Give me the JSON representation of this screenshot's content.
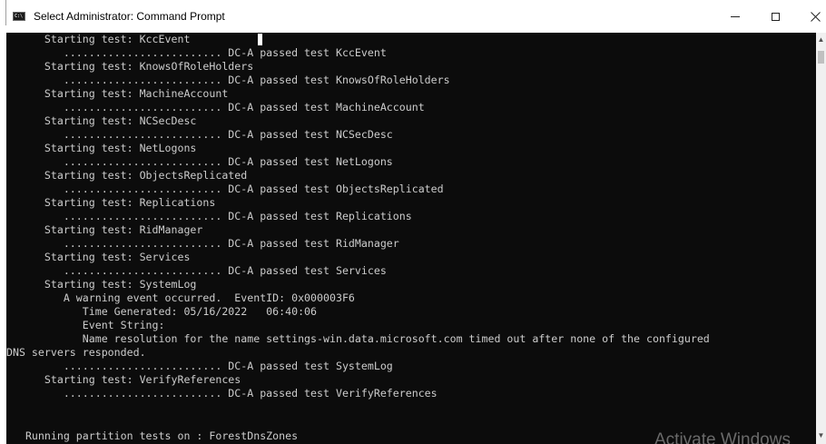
{
  "window": {
    "title": "Select Administrator: Command Prompt",
    "icon_text": "C:\\"
  },
  "console": {
    "lines": [
      "      Starting test: KccEvent",
      "         ......................... DC-A passed test KccEvent",
      "      Starting test: KnowsOfRoleHolders",
      "         ......................... DC-A passed test KnowsOfRoleHolders",
      "      Starting test: MachineAccount",
      "         ......................... DC-A passed test MachineAccount",
      "      Starting test: NCSecDesc",
      "         ......................... DC-A passed test NCSecDesc",
      "      Starting test: NetLogons",
      "         ......................... DC-A passed test NetLogons",
      "      Starting test: ObjectsReplicated",
      "         ......................... DC-A passed test ObjectsReplicated",
      "      Starting test: Replications",
      "         ......................... DC-A passed test Replications",
      "      Starting test: RidManager",
      "         ......................... DC-A passed test RidManager",
      "      Starting test: Services",
      "         ......................... DC-A passed test Services",
      "      Starting test: SystemLog",
      "         A warning event occurred.  EventID: 0x000003F6",
      "            Time Generated: 05/16/2022   06:40:06",
      "            Event String:",
      "            Name resolution for the name settings-win.data.microsoft.com timed out after none of the configured",
      "DNS servers responded.",
      "         ......................... DC-A passed test SystemLog",
      "      Starting test: VerifyReferences",
      "         ......................... DC-A passed test VerifyReferences",
      "",
      "",
      "   Running partition tests on : ForestDnsZones"
    ]
  },
  "watermark": "Activate Windows",
  "icons": {
    "minimize": "minimize-icon",
    "maximize": "maximize-icon",
    "close": "close-icon",
    "scroll_up": "scroll-up-arrow-icon",
    "scroll_down": "scroll-down-arrow-icon"
  },
  "colors": {
    "console_background": "#0c0c0c",
    "console_text": "#cccccc",
    "titlebar_background": "#ffffff"
  }
}
